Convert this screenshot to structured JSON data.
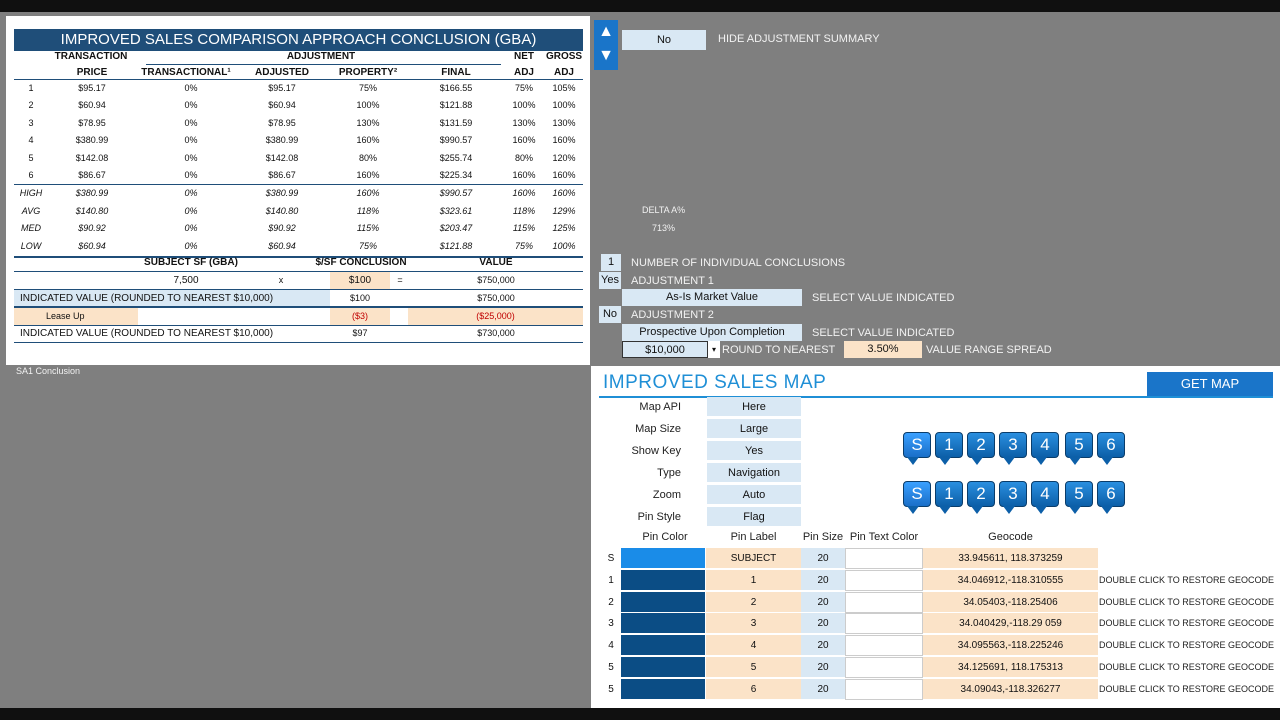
{
  "conclusion": {
    "title": "IMPROVED SALES COMPARISON APPROACH CONCLUSION (GBA)",
    "headers": {
      "transaction": "TRANSACTION",
      "adjustment": "ADJUSTMENT",
      "net": "NET",
      "gross": "GROSS",
      "price": "PRICE",
      "transactional": "TRANSACTIONAL¹",
      "adjusted": "ADJUSTED",
      "property": "PROPERTY²",
      "final": "FINAL",
      "adj1": "ADJ",
      "adj2": "ADJ"
    },
    "rows": [
      {
        "n": "1",
        "price": "$95.17",
        "trans": "0%",
        "adjusted": "$95.17",
        "property": "75%",
        "final": "$166.55",
        "net": "75%",
        "gross": "105%"
      },
      {
        "n": "2",
        "price": "$60.94",
        "trans": "0%",
        "adjusted": "$60.94",
        "property": "100%",
        "final": "$121.88",
        "net": "100%",
        "gross": "100%"
      },
      {
        "n": "3",
        "price": "$78.95",
        "trans": "0%",
        "adjusted": "$78.95",
        "property": "130%",
        "final": "$131.59",
        "net": "130%",
        "gross": "130%"
      },
      {
        "n": "4",
        "price": "$380.99",
        "trans": "0%",
        "adjusted": "$380.99",
        "property": "160%",
        "final": "$990.57",
        "net": "160%",
        "gross": "160%"
      },
      {
        "n": "5",
        "price": "$142.08",
        "trans": "0%",
        "adjusted": "$142.08",
        "property": "80%",
        "final": "$255.74",
        "net": "80%",
        "gross": "120%"
      },
      {
        "n": "6",
        "price": "$86.67",
        "trans": "0%",
        "adjusted": "$86.67",
        "property": "160%",
        "final": "$225.34",
        "net": "160%",
        "gross": "160%"
      }
    ],
    "stats": [
      {
        "n": "HIGH",
        "price": "$380.99",
        "trans": "0%",
        "adjusted": "$380.99",
        "property": "160%",
        "final": "$990.57",
        "net": "160%",
        "gross": "160%"
      },
      {
        "n": "AVG",
        "price": "$140.80",
        "trans": "0%",
        "adjusted": "$140.80",
        "property": "118%",
        "final": "$323.61",
        "net": "118%",
        "gross": "129%"
      },
      {
        "n": "MED",
        "price": "$90.92",
        "trans": "0%",
        "adjusted": "$90.92",
        "property": "115%",
        "final": "$203.47",
        "net": "115%",
        "gross": "125%"
      },
      {
        "n": "LOW",
        "price": "$60.94",
        "trans": "0%",
        "adjusted": "$60.94",
        "property": "75%",
        "final": "$121.88",
        "net": "75%",
        "gross": "100%"
      }
    ],
    "subject_sf_label": "SUBJECT SF (GBA)",
    "psf_label": "$/SF CONCLUSION",
    "value_label": "VALUE",
    "sf": "7,500",
    "times": "x",
    "psf": "$100",
    "equals": "=",
    "value": "$750,000",
    "indicated_label": "INDICATED VALUE (ROUNDED TO NEAREST $10,000)",
    "indicated_psf": "$100",
    "indicated_value": "$750,000",
    "leaseup_label": "Lease Up",
    "leaseup_psf": "($3)",
    "leaseup_value": "($25,000)",
    "indicated2_label": "INDICATED VALUE (ROUNDED TO NEAREST $10,000)",
    "indicated2_psf": "$97",
    "indicated2_value": "$730,000"
  },
  "sheet_tab": "SA1 Conclusion",
  "controls": {
    "up_arrow": "▲",
    "down_arrow": "▼",
    "hide_value": "No",
    "hide_label": "HIDE ADJUSTMENT SUMMARY",
    "delta_label": "DELTA A%",
    "delta_value": "713%",
    "num_value": "1",
    "num_label": "NUMBER OF INDIVIDUAL CONCLUSIONS",
    "adj1_flag": "Yes",
    "adj1_label": "ADJUSTMENT 1",
    "adj1_select": "As-Is Market Value",
    "adj1_hint": "SELECT VALUE INDICATED",
    "adj2_flag": "No",
    "adj2_label": "ADJUSTMENT 2",
    "adj2_select": "Prospective Upon Completion",
    "adj2_hint": "SELECT VALUE INDICATED",
    "round_value": "$10,000",
    "round_label": "ROUND TO NEAREST",
    "spread_value": "3.50%",
    "spread_label": "VALUE RANGE SPREAD"
  },
  "map": {
    "title": "IMPROVED SALES MAP",
    "get_map": "GET MAP",
    "settings": [
      {
        "label": "Map API",
        "value": "Here"
      },
      {
        "label": "Map Size",
        "value": "Large"
      },
      {
        "label": "Show Key",
        "value": "Yes"
      },
      {
        "label": "Type",
        "value": "Navigation"
      },
      {
        "label": "Zoom",
        "value": "Auto"
      },
      {
        "label": "Pin Style",
        "value": "Flag"
      }
    ],
    "pins_row1": [
      "S",
      "1",
      "2",
      "3",
      "4",
      "5",
      "6"
    ],
    "pins_row2": [
      "S",
      "1",
      "2",
      "3",
      "4",
      "5",
      "6"
    ],
    "table_headers": {
      "color": "Pin Color",
      "label": "Pin Label",
      "size": "Pin Size",
      "text": "Pin Text Color",
      "geo": "Geocode"
    },
    "table": [
      {
        "id": "S",
        "label": "SUBJECT",
        "size": "20",
        "geo": "33.945611, 118.373259",
        "action": "",
        "color": "#1a8ce8"
      },
      {
        "id": "1",
        "label": "1",
        "size": "20",
        "geo": "34.046912,-118.310555",
        "action": "DOUBLE CLICK TO RESTORE GEOCODE",
        "color": "#0b4d85"
      },
      {
        "id": "2",
        "label": "2",
        "size": "20",
        "geo": "34.05403,-118.25406",
        "action": "DOUBLE CLICK TO RESTORE GEOCODE",
        "color": "#0b4d85"
      },
      {
        "id": "3",
        "label": "3",
        "size": "20",
        "geo": "34.040429,-118.29 059",
        "action": "DOUBLE CLICK TO RESTORE GEOCODE",
        "color": "#0b4d85"
      },
      {
        "id": "4",
        "label": "4",
        "size": "20",
        "geo": "34.095563,-118.225246",
        "action": "DOUBLE CLICK TO RESTORE GEOCODE",
        "color": "#0b4d85"
      },
      {
        "id": "5",
        "label": "5",
        "size": "20",
        "geo": "34.125691, 118.175313",
        "action": "DOUBLE CLICK TO RESTORE GEOCODE",
        "color": "#0b4d85"
      },
      {
        "id": "5",
        "label": "6",
        "size": "20",
        "geo": "34.09043,-118.326277",
        "action": "DOUBLE CLICK TO RESTORE GEOCODE",
        "color": "#0b4d85"
      }
    ]
  }
}
